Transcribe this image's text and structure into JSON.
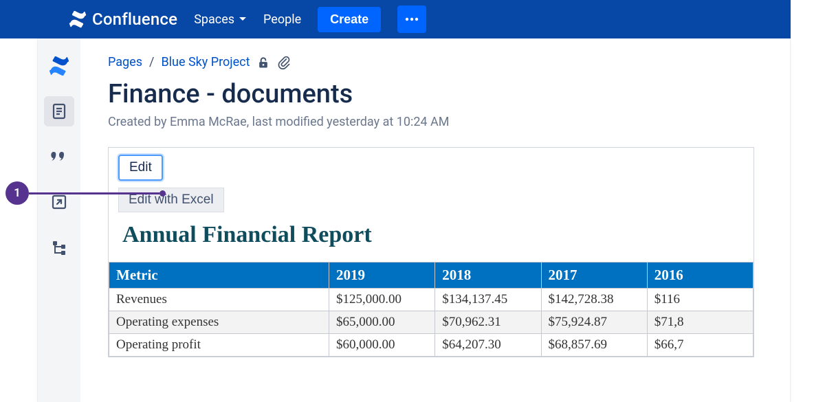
{
  "header": {
    "product": "Confluence",
    "nav_spaces": "Spaces",
    "nav_people": "People",
    "create_label": "Create"
  },
  "sidebar": {
    "items": [
      "app-home-icon",
      "pages-icon",
      "blog-icon",
      "shortcut-icon",
      "page-tree-icon"
    ]
  },
  "breadcrumb": {
    "root": "Pages",
    "project": "Blue Sky Project"
  },
  "page": {
    "title": "Finance - documents",
    "byline": "Created by Emma McRae, last modified yesterday at 10:24 AM"
  },
  "doc": {
    "edit_label": "Edit",
    "edit_excel_label": "Edit with Excel",
    "title": "Annual Financial Report"
  },
  "table": {
    "columns": [
      "Metric",
      "2019",
      "2018",
      "2017",
      "2016"
    ],
    "rows": [
      [
        "Revenues",
        "$125,000.00",
        "$134,137.45",
        "$142,728.38",
        "$116"
      ],
      [
        "Operating expenses",
        "$65,000.00",
        "$70,962.31",
        "$75,924.87",
        "$71,8"
      ],
      [
        "Operating profit",
        "$60,000.00",
        "$64,207.30",
        "$68,857.69",
        "$66,7"
      ]
    ]
  },
  "callout": {
    "number": "1"
  },
  "chart_data": {
    "type": "table",
    "title": "Annual Financial Report",
    "columns": [
      "Metric",
      "2019",
      "2018",
      "2017"
    ],
    "rows": [
      {
        "Metric": "Revenues",
        "2019": 125000.0,
        "2018": 134137.45,
        "2017": 142728.38
      },
      {
        "Metric": "Operating expenses",
        "2019": 65000.0,
        "2018": 70962.31,
        "2017": 75924.87
      },
      {
        "Metric": "Operating profit",
        "2019": 60000.0,
        "2018": 64207.3,
        "2017": 68857.69
      }
    ],
    "note": "2016 column partially truncated in source image"
  }
}
